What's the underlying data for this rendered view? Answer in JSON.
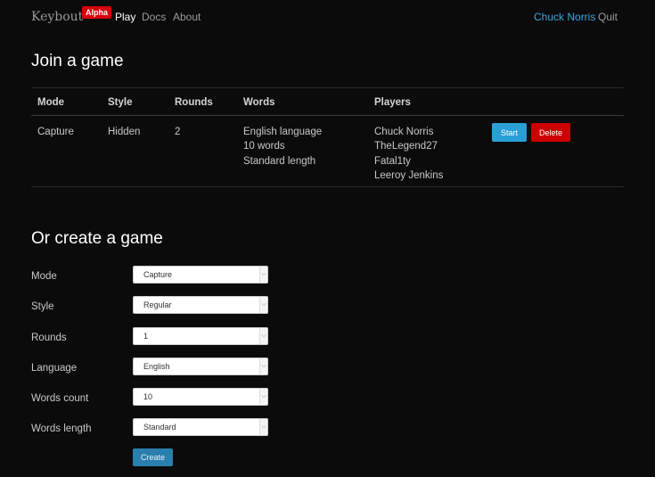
{
  "nav": {
    "brand": "Keybout",
    "badge": "Alpha",
    "links": [
      "Play",
      "Docs",
      "About"
    ],
    "user": "Chuck Norris",
    "quit": "Quit"
  },
  "join": {
    "title": "Join a game",
    "columns": [
      "Mode",
      "Style",
      "Rounds",
      "Words",
      "Players"
    ],
    "games": [
      {
        "mode": "Capture",
        "style": "Hidden",
        "rounds": "2",
        "words": [
          "English language",
          "10 words",
          "Standard length"
        ],
        "players": [
          "Chuck Norris",
          "TheLegend27",
          "Fatal1ty",
          "Leeroy Jenkins"
        ],
        "start_label": "Start",
        "delete_label": "Delete"
      }
    ]
  },
  "create": {
    "title": "Or create a game",
    "fields": [
      {
        "label": "Mode",
        "value": "Capture"
      },
      {
        "label": "Style",
        "value": "Regular"
      },
      {
        "label": "Rounds",
        "value": "1"
      },
      {
        "label": "Language",
        "value": "English"
      },
      {
        "label": "Words count",
        "value": "10"
      },
      {
        "label": "Words length",
        "value": "Standard"
      }
    ],
    "create_label": "Create"
  },
  "colors": {
    "background": "#0b0b0b",
    "accent": "#2a9fd6",
    "danger": "#cc0000",
    "brand_badge": "#d9000b"
  },
  "icons": {
    "select_arrow": "chevron-down-icon"
  }
}
